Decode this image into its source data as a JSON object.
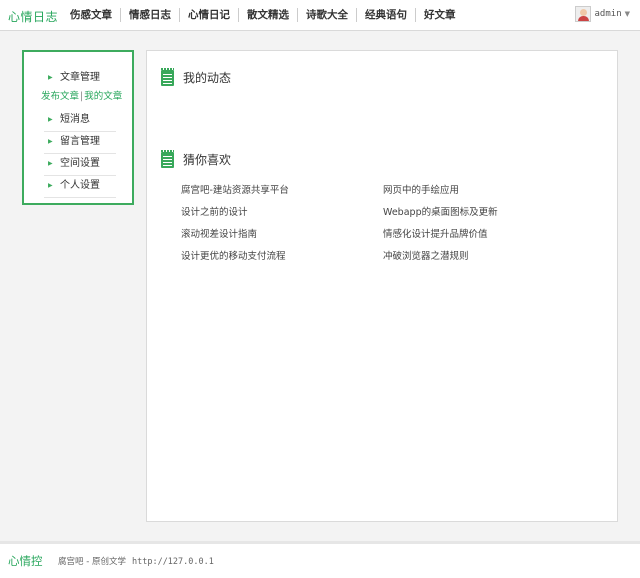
{
  "header": {
    "logo": "心情日志",
    "nav": [
      "伤感文章",
      "情感日志",
      "心情日记",
      "散文精选",
      "诗歌大全",
      "经典语句",
      "好文章"
    ],
    "user": {
      "name": "admin",
      "caret_icon": "caret-down-icon"
    }
  },
  "sidebar": {
    "article_manage": "文章管理",
    "publish_link": "发布文章",
    "divider": "|",
    "my_articles_link": "我的文章",
    "items": [
      "短消息",
      "留言管理",
      "空间设置",
      "个人设置"
    ],
    "bullet_icon": "triangle-right-icon",
    "border_color": "#3dab5e"
  },
  "main": {
    "activity_title": "我的动态",
    "recommend_title": "猜你喜欢",
    "section_icon": "notepad-icon",
    "recommendations": [
      "腐宫吧-建站资源共享平台",
      "网页中的手绘应用",
      "设计之前的设计",
      "Webapp的桌面图标及更新",
      "滚动视差设计指南",
      "情感化设计提升品牌价值",
      "设计更优的移动支付流程",
      "冲破浏览器之潜规则"
    ]
  },
  "footer": {
    "logo": "心情控",
    "text": "腐宫吧 - 原创文学",
    "url": "http://127.0.0.1"
  },
  "colors": {
    "accent": "#26a65b"
  }
}
